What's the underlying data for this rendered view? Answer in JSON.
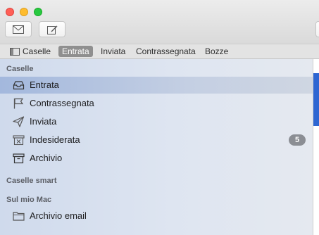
{
  "toolbar": {
    "buttons": [
      {
        "name": "get-mail",
        "icon": "envelope-icon"
      },
      {
        "name": "new-message",
        "icon": "compose-icon"
      }
    ]
  },
  "favorites": {
    "caselle": "Caselle",
    "items": [
      "Entrata",
      "Inviata",
      "Contrassegnata",
      "Bozze"
    ],
    "selected": "Entrata"
  },
  "sidebar": {
    "sections": {
      "caselle": "Caselle",
      "smart": "Caselle smart",
      "mac": "Sul mio Mac"
    },
    "mailboxes": [
      {
        "label": "Entrata",
        "icon": "inbox-tray-icon",
        "selected": true
      },
      {
        "label": "Contrassegnata",
        "icon": "flag-icon"
      },
      {
        "label": "Inviata",
        "icon": "paper-plane-icon"
      },
      {
        "label": "Indesiderata",
        "icon": "junk-tray-icon",
        "badge": "5"
      },
      {
        "label": "Archivio",
        "icon": "archive-box-icon"
      }
    ],
    "mac_items": [
      {
        "label": "Archivio email",
        "icon": "folder-icon"
      }
    ]
  },
  "colors": {
    "selection_accent": "#2e66d2",
    "badge": "#8b8e94"
  }
}
